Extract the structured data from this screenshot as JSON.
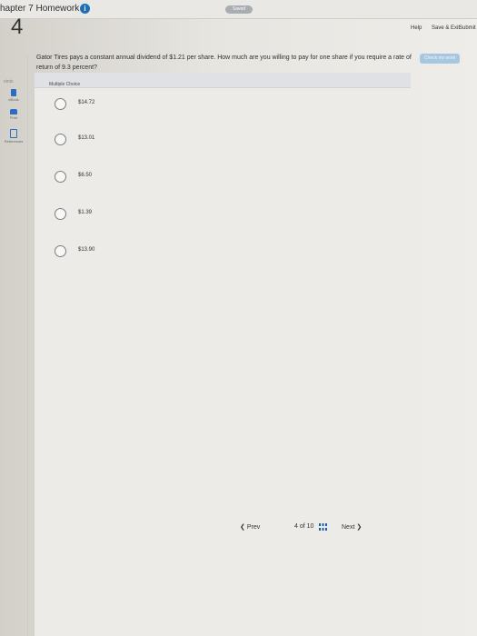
{
  "header": {
    "chapter_title": "hapter 7 Homework",
    "info_icon": "info-icon",
    "saved_label": "Saved",
    "help_label": "Help",
    "save_exit_label": "Save & Exit",
    "submit_label": "Submit",
    "check_button_label": "Check my work"
  },
  "sidebar": {
    "question_number": "4",
    "points_label": "oints",
    "items": [
      {
        "label": "eBook",
        "icon": "ebook-icon"
      },
      {
        "label": "Print",
        "icon": "print-icon"
      },
      {
        "label": "References",
        "icon": "references-icon"
      }
    ]
  },
  "question": {
    "text": "Gator Tires pays a constant annual dividend of $1.21 per share. How much are you willing to pay for one share if you require a rate of return of 9.3 percent?",
    "type_label": "Multiple Choice",
    "options": [
      "$14.72",
      "$13.01",
      "$6.50",
      "$1.39",
      "$13.90"
    ]
  },
  "navigation": {
    "prev_label": "Prev",
    "page_current": "4",
    "page_separator": "of",
    "page_total": "10",
    "next_label": "Next"
  }
}
